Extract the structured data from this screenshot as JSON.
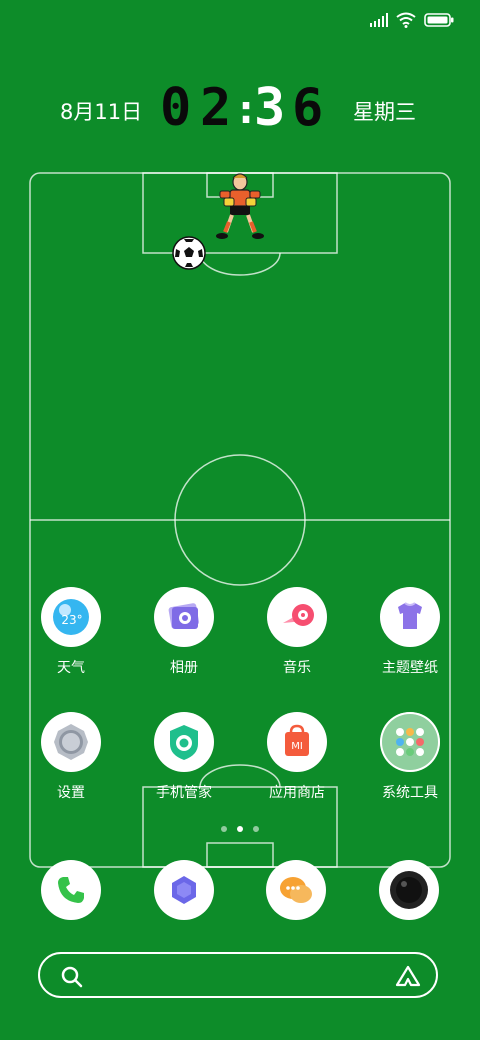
{
  "status_bar": {
    "signal_icon": "signal-icon",
    "wifi_icon": "wifi-icon",
    "battery_icon": "battery-icon"
  },
  "clock": {
    "date": "8月11日",
    "hour_1": "0",
    "hour_2": "2",
    "separator": ":",
    "minute_1": "3",
    "minute_2": "6",
    "weekday": "星期三"
  },
  "wallpaper": {
    "theme": "soccer-field",
    "goalkeeper_icon": "goalkeeper-icon",
    "ball_icon": "soccer-ball-icon"
  },
  "apps": [
    {
      "label": "天气",
      "icon": "weather-icon",
      "value": "23°"
    },
    {
      "label": "相册",
      "icon": "gallery-icon"
    },
    {
      "label": "音乐",
      "icon": "music-icon"
    },
    {
      "label": "主题壁纸",
      "icon": "themes-icon"
    },
    {
      "label": "设置",
      "icon": "settings-icon"
    },
    {
      "label": "手机管家",
      "icon": "security-icon"
    },
    {
      "label": "应用商店",
      "icon": "app-store-icon",
      "badge": "MI"
    },
    {
      "label": "系统工具",
      "icon": "tools-folder-icon"
    }
  ],
  "page_indicator": {
    "count": 3,
    "active": 2
  },
  "dock": [
    {
      "icon": "phone-icon"
    },
    {
      "icon": "browser-icon"
    },
    {
      "icon": "messages-icon"
    },
    {
      "icon": "camera-icon"
    }
  ],
  "search_bar": {
    "search_icon": "search-icon",
    "assistant_icon": "assistant-icon"
  },
  "colors": {
    "background": "#0d8c29",
    "field_lines": "#ffffff",
    "digits": "#0a0a0a"
  }
}
